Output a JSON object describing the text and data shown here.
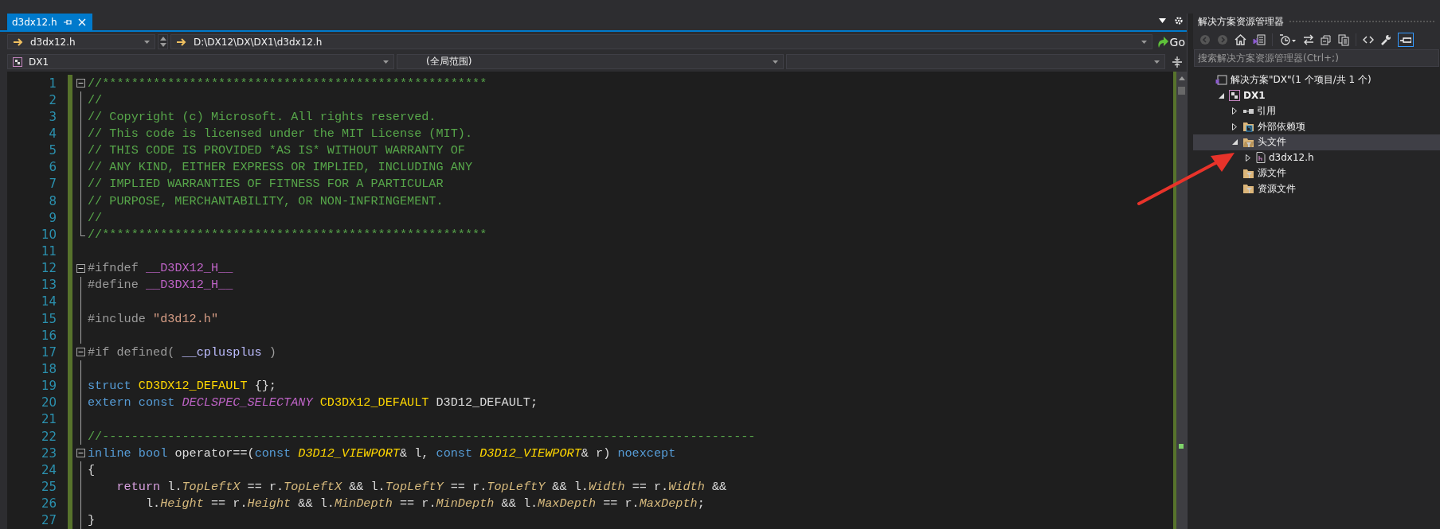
{
  "editor_tab": {
    "title": "d3dx12.h",
    "selected": true
  },
  "navigation": {
    "file_combo": "d3dx12.h",
    "path_combo": "D:\\DX12\\DX\\DX1\\d3dx12.h",
    "go_button": "Go"
  },
  "scope": {
    "project_combo": "DX1",
    "scope_combo": "(全局范围)"
  },
  "code_lines": [
    {
      "number": "1",
      "kind": "fold_start",
      "tokens": [
        {
          "kind": "comment",
          "text": "//*****************************************************"
        }
      ]
    },
    {
      "number": "2",
      "kind": "fold_body",
      "tokens": [
        {
          "kind": "comment",
          "text": "//"
        }
      ]
    },
    {
      "number": "3",
      "kind": "fold_body",
      "tokens": [
        {
          "kind": "comment",
          "text": "// Copyright (c) Microsoft. All rights reserved."
        }
      ]
    },
    {
      "number": "4",
      "kind": "fold_body",
      "tokens": [
        {
          "kind": "comment",
          "text": "// This code is licensed under the MIT License (MIT)."
        }
      ]
    },
    {
      "number": "5",
      "kind": "fold_body",
      "tokens": [
        {
          "kind": "comment",
          "text": "// THIS CODE IS PROVIDED *AS IS* WITHOUT WARRANTY OF"
        }
      ]
    },
    {
      "number": "6",
      "kind": "fold_body",
      "tokens": [
        {
          "kind": "comment",
          "text": "// ANY KIND, EITHER EXPRESS OR IMPLIED, INCLUDING ANY"
        }
      ]
    },
    {
      "number": "7",
      "kind": "fold_body",
      "tokens": [
        {
          "kind": "comment",
          "text": "// IMPLIED WARRANTIES OF FITNESS FOR A PARTICULAR"
        }
      ]
    },
    {
      "number": "8",
      "kind": "fold_body",
      "tokens": [
        {
          "kind": "comment",
          "text": "// PURPOSE, MERCHANTABILITY, OR NON-INFRINGEMENT."
        }
      ]
    },
    {
      "number": "9",
      "kind": "fold_body",
      "tokens": [
        {
          "kind": "comment",
          "text": "//"
        }
      ]
    },
    {
      "number": "10",
      "kind": "fold_end",
      "tokens": [
        {
          "kind": "comment",
          "text": "//*****************************************************"
        }
      ]
    },
    {
      "number": "11",
      "kind": "plain"
    },
    {
      "number": "12",
      "kind": "fold_start",
      "tokens": [
        {
          "kind": "preprocessor",
          "text": "#ifndef "
        },
        {
          "kind": "macro",
          "text": "__D3DX12_H__"
        }
      ]
    },
    {
      "number": "13",
      "kind": "fold_body",
      "tokens": [
        {
          "kind": "preprocessor",
          "text": "#define "
        },
        {
          "kind": "macro",
          "text": "__D3DX12_H__"
        }
      ]
    },
    {
      "number": "14",
      "kind": "fold_body"
    },
    {
      "number": "15",
      "kind": "fold_body",
      "tokens": [
        {
          "kind": "preprocessor",
          "text": "#include "
        },
        {
          "kind": "string",
          "text": "\"d3d12.h\""
        }
      ]
    },
    {
      "number": "16",
      "kind": "fold_body"
    },
    {
      "number": "17",
      "kind": "fold_start",
      "tokens": [
        {
          "kind": "preprocessor",
          "text": "#if defined( "
        },
        {
          "kind": "macro_plain",
          "text": "__cplusplus"
        },
        {
          "kind": "preprocessor",
          "text": " )"
        }
      ]
    },
    {
      "number": "18",
      "kind": "fold_body"
    },
    {
      "number": "19",
      "kind": "fold_body",
      "tokens": [
        {
          "kind": "keyword",
          "text": "struct "
        },
        {
          "kind": "type",
          "text": "CD3DX12_DEFAULT"
        },
        {
          "kind": "plain",
          "text": " {};"
        }
      ]
    },
    {
      "number": "20",
      "kind": "fold_body",
      "tokens": [
        {
          "kind": "keyword",
          "text": "extern const "
        },
        {
          "kind": "macro_italic",
          "text": "DECLSPEC_SELECTANY "
        },
        {
          "kind": "type",
          "text": "CD3DX12_DEFAULT"
        },
        {
          "kind": "plain",
          "text": " D3D12_DEFAULT;"
        }
      ]
    },
    {
      "number": "21",
      "kind": "fold_body"
    },
    {
      "number": "22",
      "kind": "fold_body",
      "tokens": [
        {
          "kind": "comment",
          "text": "//------------------------------------------------------------------------------------------"
        }
      ]
    },
    {
      "number": "23",
      "kind": "fold_start",
      "tokens": [
        {
          "kind": "keyword",
          "text": "inline bool "
        },
        {
          "kind": "plain",
          "text": "operator==("
        },
        {
          "kind": "keyword",
          "text": "const "
        },
        {
          "kind": "type_italic",
          "text": "D3D12_VIEWPORT"
        },
        {
          "kind": "plain",
          "text": "& l, "
        },
        {
          "kind": "keyword",
          "text": "const "
        },
        {
          "kind": "type_italic",
          "text": "D3D12_VIEWPORT"
        },
        {
          "kind": "plain",
          "text": "& r) "
        },
        {
          "kind": "keyword",
          "text": "noexcept"
        }
      ]
    },
    {
      "number": "24",
      "kind": "fold_body",
      "tokens": [
        {
          "kind": "plain",
          "text": "{"
        }
      ]
    },
    {
      "number": "25",
      "kind": "fold_body",
      "tokens": [
        {
          "kind": "control",
          "text": "    return "
        },
        {
          "kind": "plain",
          "text": "l."
        },
        {
          "kind": "member",
          "text": "TopLeftX"
        },
        {
          "kind": "plain",
          "text": " == r."
        },
        {
          "kind": "member",
          "text": "TopLeftX"
        },
        {
          "kind": "plain",
          "text": " && l."
        },
        {
          "kind": "member",
          "text": "TopLeftY"
        },
        {
          "kind": "plain",
          "text": " == r."
        },
        {
          "kind": "member",
          "text": "TopLeftY"
        },
        {
          "kind": "plain",
          "text": " && l."
        },
        {
          "kind": "member",
          "text": "Width"
        },
        {
          "kind": "plain",
          "text": " == r."
        },
        {
          "kind": "member",
          "text": "Width"
        },
        {
          "kind": "plain",
          "text": " &&"
        }
      ]
    },
    {
      "number": "26",
      "kind": "fold_body",
      "tokens": [
        {
          "kind": "plain",
          "text": "        l."
        },
        {
          "kind": "member",
          "text": "Height"
        },
        {
          "kind": "plain",
          "text": " == r."
        },
        {
          "kind": "member",
          "text": "Height"
        },
        {
          "kind": "plain",
          "text": " && l."
        },
        {
          "kind": "member",
          "text": "MinDepth"
        },
        {
          "kind": "plain",
          "text": " == r."
        },
        {
          "kind": "member",
          "text": "MinDepth"
        },
        {
          "kind": "plain",
          "text": " && l."
        },
        {
          "kind": "member",
          "text": "MaxDepth"
        },
        {
          "kind": "plain",
          "text": " == r."
        },
        {
          "kind": "member",
          "text": "MaxDepth"
        },
        {
          "kind": "plain",
          "text": ";"
        }
      ]
    },
    {
      "number": "27",
      "kind": "fold_body",
      "tokens": [
        {
          "kind": "plain",
          "text": "}"
        }
      ]
    }
  ],
  "solution_explorer": {
    "title": "解决方案资源管理器",
    "search": {
      "placeholder": "搜索解决方案资源管理器(Ctrl+;)"
    },
    "tree": [
      {
        "label": "解决方案\"DX\"(1 个项目/共 1 个)",
        "kind": "solution",
        "selected": false,
        "children": [
          {
            "label": "DX1",
            "kind": "project",
            "expanded": true,
            "selected": false,
            "children": [
              {
                "label": "引用",
                "kind": "references",
                "expanded": false,
                "selected": false
              },
              {
                "label": "外部依赖项",
                "kind": "external",
                "expanded": false,
                "selected": false
              },
              {
                "label": "头文件",
                "kind": "filter_open",
                "expanded": true,
                "selected": true,
                "children": [
                  {
                    "label": "d3dx12.h",
                    "kind": "header",
                    "expanded": false,
                    "selected": false
                  }
                ]
              },
              {
                "label": "源文件",
                "kind": "filter",
                "selected": false
              },
              {
                "label": "资源文件",
                "kind": "filter",
                "selected": false
              }
            ]
          }
        ]
      }
    ]
  }
}
